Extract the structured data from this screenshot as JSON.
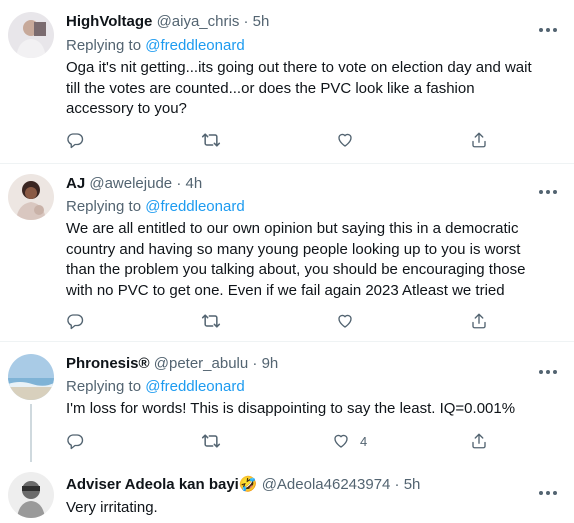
{
  "tweets": [
    {
      "name": "HighVoltage",
      "handle": "@aiya_chris",
      "time": "5h",
      "replying_prefix": "Replying to",
      "replying_to": "@freddleonard",
      "text": "Oga it's nit getting...its going out there to vote on election day and wait till the votes are counted...or does the PVC look like a fashion accessory to you?",
      "likes": ""
    },
    {
      "name": "AJ",
      "handle": "@awelejude",
      "time": "4h",
      "replying_prefix": "Replying to",
      "replying_to": "@freddleonard",
      "text": "We are all entitled to our own opinion but saying this in a democratic country and having so many young people looking up to you is worst than the problem you talking about, you should be encouraging those with no PVC to get one. Even if we fail again 2023 Atleast we tried",
      "likes": ""
    },
    {
      "name": "Phronesis®",
      "handle": "@peter_abulu",
      "time": "9h",
      "replying_prefix": "Replying to",
      "replying_to": "@freddleonard",
      "text": "I'm loss for words! This is disappointing to say the least. IQ=0.001%",
      "likes": "4"
    },
    {
      "name": "Adviser Adeola kan bayi🤣",
      "handle": "@Adeola46243974",
      "time": "5h",
      "text": "Very irritating."
    }
  ],
  "separator": "·",
  "icons": [
    "more-icon",
    "reply-icon",
    "retweet-icon",
    "like-icon",
    "share-icon"
  ],
  "colors": {
    "link": "#1d9bf0",
    "muted": "#536471",
    "text": "#0f1419"
  }
}
